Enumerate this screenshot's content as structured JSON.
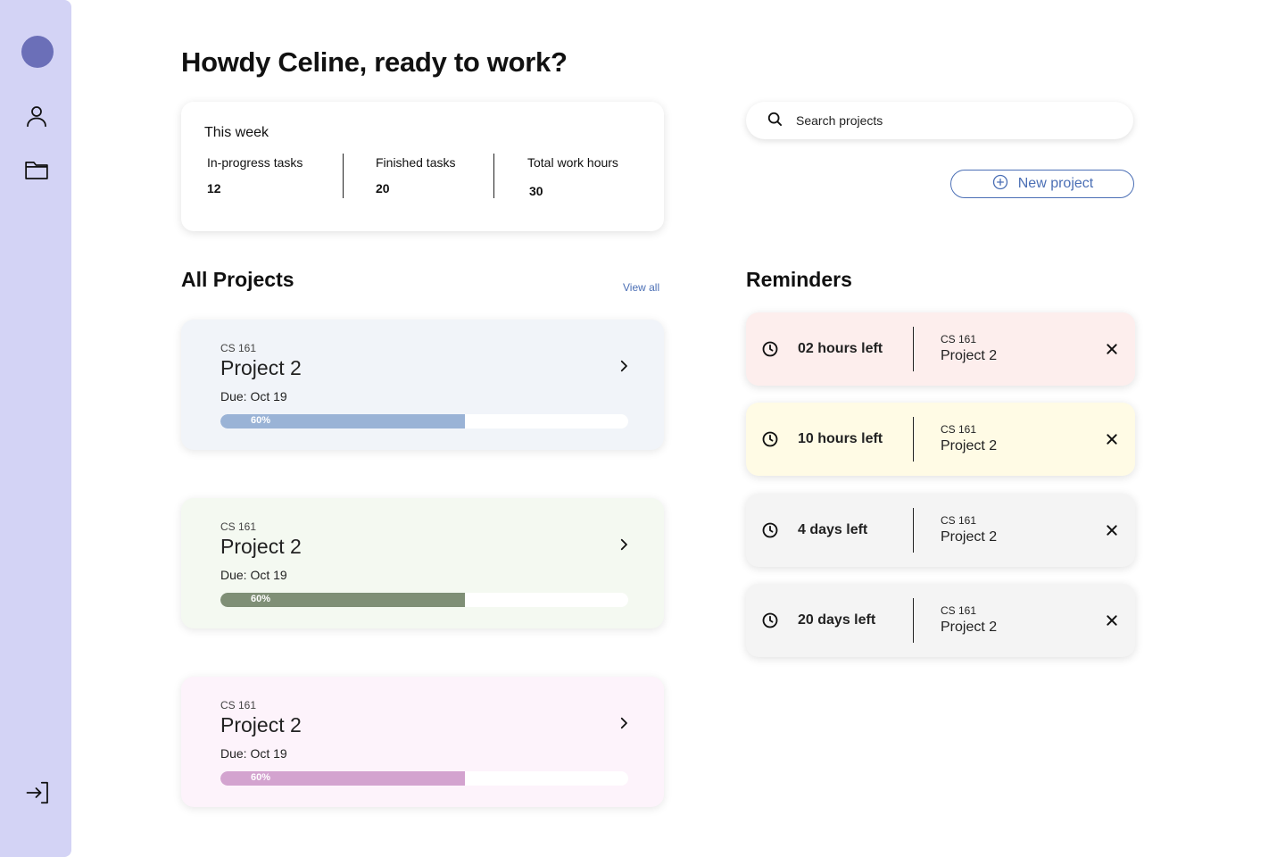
{
  "sidebar": {
    "items": [
      {
        "name": "avatar"
      },
      {
        "icon": "user-icon"
      },
      {
        "icon": "folder-icon"
      },
      {
        "icon": "logout-icon"
      }
    ]
  },
  "header": {
    "greeting": "Howdy Celine, ready to work?"
  },
  "week": {
    "title": "This week",
    "stats": [
      {
        "label": "In-progress tasks",
        "value": "12"
      },
      {
        "label": "Finished tasks",
        "value": "20"
      },
      {
        "label": "Total work hours",
        "value": "30"
      }
    ]
  },
  "search": {
    "placeholder": "Search projects",
    "icon": "search-icon"
  },
  "new_project": {
    "label": "New project",
    "icon": "plus-circle-icon",
    "color": "#4b6fb5"
  },
  "projects": {
    "heading": "All Projects",
    "view_all": "View all",
    "cards": [
      {
        "course": "CS 161",
        "name": "Project 2",
        "due": "Due: Oct 19",
        "progress": 0.6,
        "progress_label": "60%",
        "bg": "#f1f4f9",
        "bar": "#9ab3d6"
      },
      {
        "course": "CS 161",
        "name": "Project 2",
        "due": "Due: Oct 19",
        "progress": 0.6,
        "progress_label": "60%",
        "bg": "#f4f9f1",
        "bar": "#7f8f76"
      },
      {
        "course": "CS 161",
        "name": "Project 2",
        "due": "Due: Oct 19",
        "progress": 0.6,
        "progress_label": "60%",
        "bg": "#fdf3fb",
        "bar": "#d3a3cf"
      }
    ]
  },
  "reminders": {
    "heading": "Reminders",
    "cards": [
      {
        "time": "02 hours left",
        "course": "CS 161",
        "name": "Project 2",
        "bg": "#fdeeed"
      },
      {
        "time": "10 hours left",
        "course": "CS 161",
        "name": "Project 2",
        "bg": "#fffbe5"
      },
      {
        "time": "4 days left",
        "course": "CS 161",
        "name": "Project 2",
        "bg": "#f4f4f4"
      },
      {
        "time": "20 days left",
        "course": "CS 161",
        "name": "Project 2",
        "bg": "#f4f4f4"
      }
    ]
  }
}
